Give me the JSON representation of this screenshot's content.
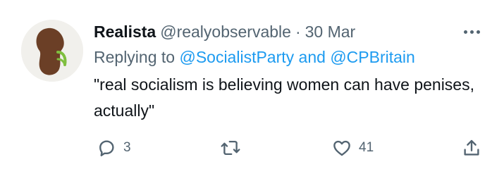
{
  "tweet": {
    "display_name": "Realista",
    "handle": "@realyobservable",
    "separator": "·",
    "date": "30 Mar",
    "replying_prefix": "Replying to",
    "mention_1": "@SocialistParty",
    "mention_join": "and",
    "mention_2": "@CPBritain",
    "text": "\"real socialism is believing women can have penises, actually\""
  },
  "actions": {
    "reply_count": "3",
    "retweet_count": "",
    "like_count": "41"
  },
  "icons": {
    "more": "more-horizontal-icon",
    "reply": "speech-bubble-icon",
    "retweet": "retweet-arrows-icon",
    "like": "heart-icon",
    "share": "share-upload-icon"
  },
  "colors": {
    "text": "#0f1419",
    "secondary": "#536471",
    "link": "#1d9bf0",
    "avatar_shape": "#6b3f26",
    "avatar_sprout": "#7fbf3f"
  }
}
